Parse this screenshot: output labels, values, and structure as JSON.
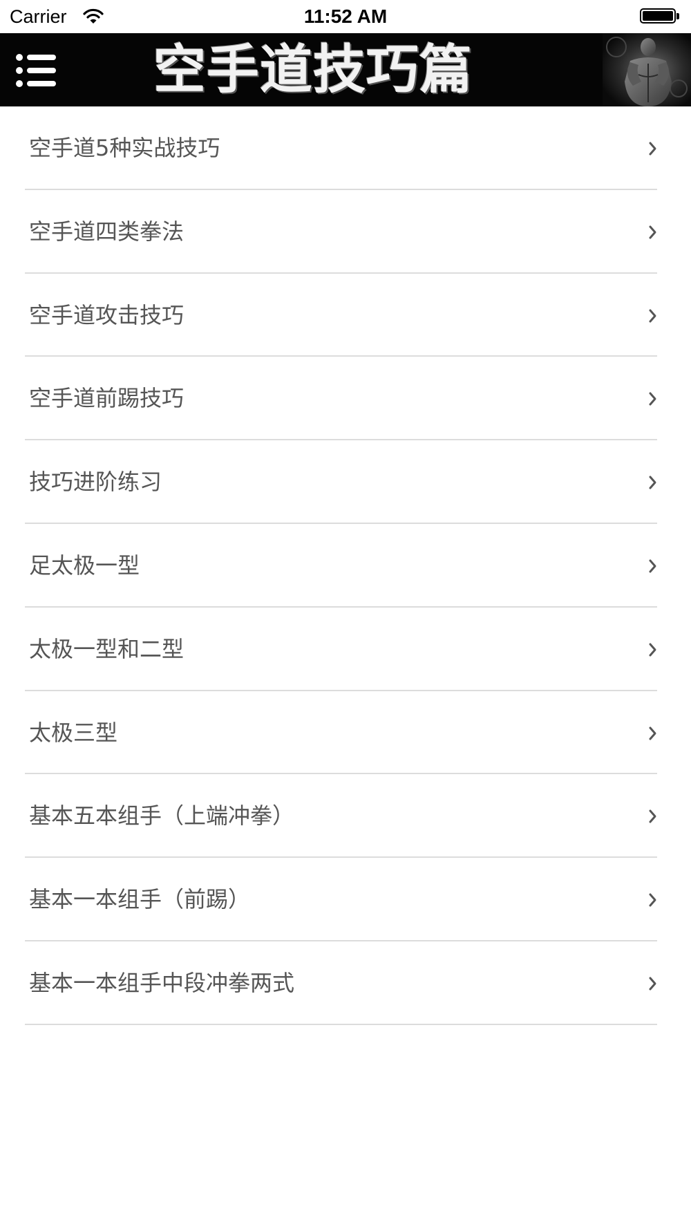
{
  "status_bar": {
    "carrier": "Carrier",
    "time": "11:52 AM",
    "battery_level": 1.0
  },
  "header": {
    "title": "空手道技巧篇",
    "background_color": "#050505",
    "menu_icon": "hamburger-list-icon",
    "photo": "muscular-man-photo"
  },
  "list": {
    "items": [
      {
        "label": "空手道5种实战技巧"
      },
      {
        "label": "空手道四类拳法"
      },
      {
        "label": "空手道攻击技巧"
      },
      {
        "label": "空手道前踢技巧"
      },
      {
        "label": "技巧进阶练习"
      },
      {
        "label": "足太极一型"
      },
      {
        "label": "太极一型和二型"
      },
      {
        "label": "太极三型"
      },
      {
        "label": "基本五本组手（上端冲拳）"
      },
      {
        "label": "基本一本组手（前踢）"
      },
      {
        "label": "基本一本组手中段冲拳两式"
      }
    ],
    "text_color": "#555555",
    "divider_color": "#dcdcdc",
    "chevron_icon": "chevron-right-icon"
  }
}
